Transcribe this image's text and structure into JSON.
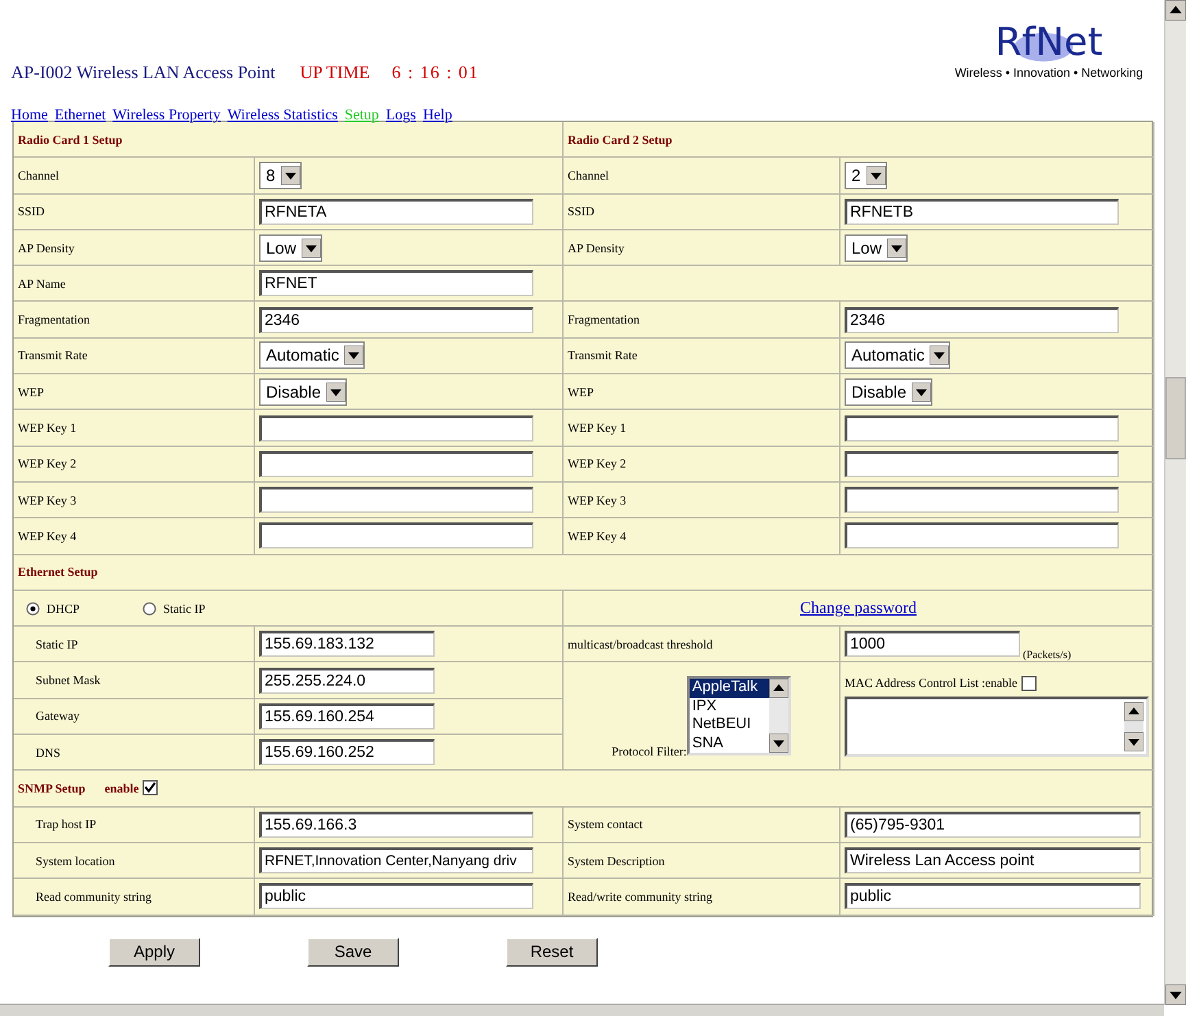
{
  "header": {
    "title": "AP-I002 Wireless LAN Access Point",
    "uptime_label": "UP TIME",
    "uptime": "6 : 16 : 01"
  },
  "logo": {
    "name": "RfNet",
    "tagline": "Wireless • Innovation • Networking"
  },
  "nav": [
    {
      "label": "Home",
      "selected": false
    },
    {
      "label": "Ethernet",
      "selected": false
    },
    {
      "label": "Wireless Property",
      "selected": false
    },
    {
      "label": "Wireless Statistics",
      "selected": false
    },
    {
      "label": "Setup",
      "selected": true
    },
    {
      "label": "Logs",
      "selected": false
    },
    {
      "label": "Help",
      "selected": false
    }
  ],
  "radio_setup": {
    "titles": [
      "Radio Card 1 Setup",
      "Radio Card 2 Setup"
    ],
    "rows": [
      {
        "left": {
          "label": "Channel",
          "kind": "select",
          "value": "8"
        },
        "right": {
          "label": "Channel",
          "kind": "select",
          "value": "2"
        }
      },
      {
        "left": {
          "label": "SSID",
          "kind": "text",
          "value": "RFNETA"
        },
        "right": {
          "label": "SSID",
          "kind": "text",
          "value": "RFNETB"
        }
      },
      {
        "left": {
          "label": "AP Density",
          "kind": "select",
          "value": "Low"
        },
        "right": {
          "label": "AP Density",
          "kind": "select",
          "value": "Low"
        }
      },
      {
        "left": {
          "label": "AP Name",
          "kind": "text",
          "value": "RFNET"
        }
      },
      {
        "left": {
          "label": "Fragmentation",
          "kind": "text",
          "value": "2346"
        },
        "right": {
          "label": "Fragmentation",
          "kind": "text",
          "value": "2346"
        }
      },
      {
        "left": {
          "label": "Transmit Rate",
          "kind": "select",
          "value": "Automatic"
        },
        "right": {
          "label": "Transmit Rate",
          "kind": "select",
          "value": "Automatic"
        }
      },
      {
        "left": {
          "label": "WEP",
          "kind": "select",
          "value": "Disable"
        },
        "right": {
          "label": "WEP",
          "kind": "select",
          "value": "Disable"
        }
      },
      {
        "left": {
          "label": "WEP Key 1",
          "kind": "text"
        },
        "right": {
          "label": "WEP Key 1",
          "kind": "text"
        }
      },
      {
        "left": {
          "label": "WEP Key 2",
          "kind": "text"
        },
        "right": {
          "label": "WEP Key 2",
          "kind": "text"
        }
      },
      {
        "left": {
          "label": "WEP Key 3",
          "kind": "text"
        },
        "right": {
          "label": "WEP Key 3",
          "kind": "text"
        }
      },
      {
        "left": {
          "label": "WEP Key 4",
          "kind": "text"
        },
        "right": {
          "label": "WEP Key 4",
          "kind": "text"
        }
      }
    ]
  },
  "ethernet_setup": {
    "title": "Ethernet Setup",
    "modes": [
      {
        "label": "DHCP",
        "selected": true
      },
      {
        "label": "Static IP",
        "selected": false
      }
    ],
    "change_password": "Change password",
    "fields": [
      {
        "label": "Static IP",
        "value": "155.69.183.132"
      },
      {
        "label": "Subnet Mask",
        "value": "255.255.224.0"
      },
      {
        "label": "Gateway",
        "value": "155.69.160.254"
      },
      {
        "label": "DNS",
        "value": "155.69.160.252"
      }
    ],
    "threshold": {
      "label": "multicast/broadcast threshold",
      "value": "1000",
      "unit": "(Packets/s)"
    },
    "protocol_filter": {
      "label": "Protocol Filter:",
      "options": [
        {
          "label": "AppleTalk",
          "selected": true
        },
        {
          "label": "IPX",
          "selected": false
        },
        {
          "label": "NetBEUI",
          "selected": false
        },
        {
          "label": "SNA",
          "selected": false
        }
      ]
    },
    "mac_control": {
      "label": "MAC Address  Control  List :enable",
      "checked": false
    }
  },
  "snmp_setup": {
    "title": "SNMP Setup",
    "enable_label": "enable",
    "enabled": true,
    "rows": [
      {
        "left": {
          "label": "Trap host IP",
          "value": "155.69.166.3"
        },
        "right": {
          "label": "System contact",
          "value": "(65)795-9301"
        }
      },
      {
        "left": {
          "label": "System location",
          "value": "RFNET,Innovation Center,Nanyang driv"
        },
        "right": {
          "label": "System Description",
          "value": "Wireless Lan Access point"
        }
      },
      {
        "left": {
          "label": "Read community string",
          "value": "public"
        },
        "right": {
          "label": "Read/write community string",
          "value": "public"
        }
      }
    ]
  },
  "buttons": [
    "Apply",
    "Save",
    "Reset"
  ]
}
